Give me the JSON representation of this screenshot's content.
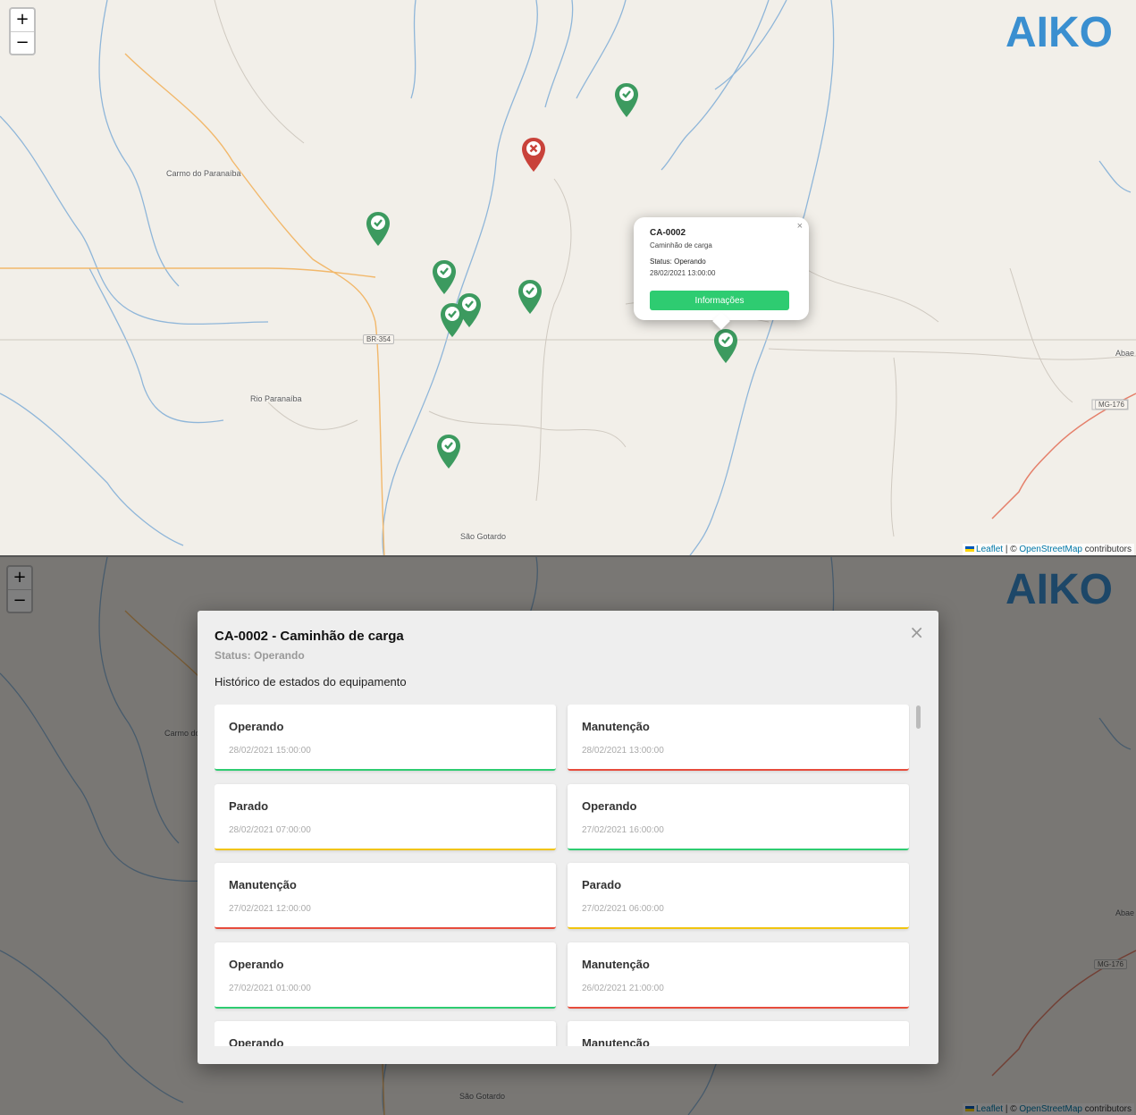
{
  "map": {
    "zoom_in": "+",
    "zoom_out": "−",
    "logo_text": "AIKO",
    "attribution": {
      "leaflet": "Leaflet",
      "sep": " | © ",
      "osm": "OpenStreetMap",
      "suffix": " contributors"
    },
    "places": {
      "carmo": "Carmo do Paranaíba",
      "rio": "Rio Paranaíba",
      "sao_gotardo": "São Gotardo",
      "abae": "Abae",
      "br354": "BR-354",
      "mg176": "MG-176"
    },
    "colors": {
      "operating": "#3c9a5f",
      "stopped": "#c9423a",
      "primary": "#2ecc71",
      "logo": "#3a8fd0"
    }
  },
  "popup": {
    "title": "CA-0002",
    "subtitle": "Caminhão de carga",
    "status": "Status: Operando",
    "date": "28/02/2021 13:00:00",
    "button": "Informações",
    "close": "×"
  },
  "modal": {
    "title": "CA-0002 - Caminhão de carga",
    "status": "Status: Operando",
    "history_label": "Histórico de estados do equipamento",
    "close": "×",
    "cards": [
      {
        "state": "Operando",
        "date": "28/02/2021 15:00:00",
        "color": "#2ecc71"
      },
      {
        "state": "Manutenção",
        "date": "28/02/2021 13:00:00",
        "color": "#e74c3c"
      },
      {
        "state": "Parado",
        "date": "28/02/2021 07:00:00",
        "color": "#f1c40f"
      },
      {
        "state": "Operando",
        "date": "27/02/2021 16:00:00",
        "color": "#2ecc71"
      },
      {
        "state": "Manutenção",
        "date": "27/02/2021 12:00:00",
        "color": "#e74c3c"
      },
      {
        "state": "Parado",
        "date": "27/02/2021 06:00:00",
        "color": "#f1c40f"
      },
      {
        "state": "Operando",
        "date": "27/02/2021 01:00:00",
        "color": "#2ecc71"
      },
      {
        "state": "Manutenção",
        "date": "26/02/2021 21:00:00",
        "color": "#e74c3c"
      },
      {
        "state": "Operando",
        "date": "",
        "color": "#2ecc71"
      },
      {
        "state": "Manutenção",
        "date": "",
        "color": "#e74c3c"
      }
    ]
  }
}
